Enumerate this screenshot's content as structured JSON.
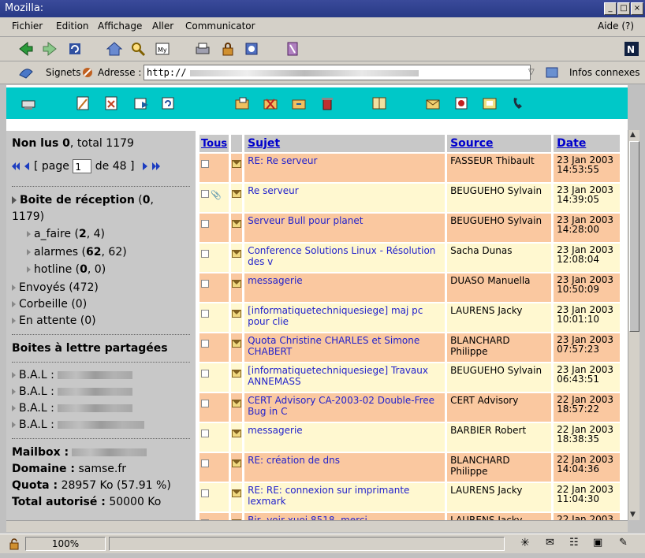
{
  "window": {
    "title": "Mozilla:"
  },
  "menu": [
    "Fichier",
    "Edition",
    "Affichage",
    "Aller",
    "Communicator"
  ],
  "help_menu": "Aide (?)",
  "location": {
    "bookmarks_label": "Signets",
    "address_label": "Adresse :",
    "url_prefix": "http://",
    "related_label": "Infos connexes"
  },
  "sidebar": {
    "unread_label": "Non lus",
    "unread_count": "0",
    "total_label": "total",
    "total_count": "1179",
    "page_prefix": "[ page",
    "page_value": "1",
    "page_suffix": "de 48 ]",
    "inbox_label": "Boite de réception",
    "inbox_unread": "0",
    "inbox_total": "1179)",
    "folders": [
      {
        "name": "a_faire",
        "unread": "2",
        "total": "4"
      },
      {
        "name": "alarmes",
        "unread": "62",
        "total": "62"
      },
      {
        "name": "hotline",
        "unread": "0",
        "total": "0"
      }
    ],
    "sent": "Envoyés (472)",
    "trash": "Corbeille (0)",
    "pending": "En attente (0)",
    "shared_title": "Boites à lettre partagées",
    "bal_label": "B.A.L :",
    "mailbox_label": "Mailbox :",
    "domain_label": "Domaine :",
    "domain_value": "samse.fr",
    "quota_label": "Quota :",
    "quota_value": "28957 Ko (57.91 %)",
    "allowed_label": "Total autorisé :",
    "allowed_value": "50000 Ko"
  },
  "table": {
    "headers": {
      "all": "Tous",
      "subject": "Sujet",
      "source": "Source",
      "date": "Date"
    },
    "rows": [
      {
        "subject": "RE: Re serveur",
        "source": "FASSEUR Thibault",
        "date": "23 Jan 2003",
        "time": "14:53:55",
        "attach": false
      },
      {
        "subject": "Re serveur",
        "source": "BEUGUEHO Sylvain",
        "date": "23 Jan 2003",
        "time": "14:39:05",
        "attach": true
      },
      {
        "subject": "Serveur Bull pour planet",
        "source": "BEUGUEHO Sylvain",
        "date": "23 Jan 2003",
        "time": "14:28:00",
        "attach": false
      },
      {
        "subject": "Conference Solutions Linux - Résolution des v",
        "source": "Sacha Dunas",
        "date": "23 Jan 2003",
        "time": "12:08:04",
        "attach": false
      },
      {
        "subject": "messagerie",
        "source": "DUASO Manuella",
        "date": "23 Jan 2003",
        "time": "10:50:09",
        "attach": false
      },
      {
        "subject": "[informatiquetechniquesiege] maj pc pour clie",
        "source": "LAURENS Jacky",
        "date": "23 Jan 2003",
        "time": "10:01:10",
        "attach": false
      },
      {
        "subject": "Quota Christine CHARLES et Simone CHABERT",
        "source": "BLANCHARD Philippe",
        "date": "23 Jan 2003",
        "time": "07:57:23",
        "attach": false
      },
      {
        "subject": "[informatiquetechniquesiege] Travaux ANNEMASS",
        "source": "BEUGUEHO Sylvain",
        "date": "23 Jan 2003",
        "time": "06:43:51",
        "attach": false
      },
      {
        "subject": "CERT Advisory CA-2003-02 Double-Free Bug in C",
        "source": "CERT Advisory",
        "date": "22 Jan 2003",
        "time": "18:57:22",
        "attach": false
      },
      {
        "subject": "messagerie",
        "source": "BARBIER Robert",
        "date": "22 Jan 2003",
        "time": "18:38:35",
        "attach": false
      },
      {
        "subject": "RE: création de dns",
        "source": "BLANCHARD Philippe",
        "date": "22 Jan 2003",
        "time": "14:04:36",
        "attach": false
      },
      {
        "subject": "RE: RE: connexion sur imprimante lexmark",
        "source": "LAURENS Jacky",
        "date": "22 Jan 2003",
        "time": "11:04:30",
        "attach": false
      },
      {
        "subject": "Bjr, voir xuoi 8518, merci",
        "source": "LAURENS Jacky",
        "date": "22 Jan 2003",
        "time": "",
        "attach": false
      }
    ]
  },
  "status": {
    "zoom": "100%"
  },
  "colors": {
    "odd_row": "#fac8a0",
    "even_row": "#fff8d0",
    "toolbar": "#00c8c8",
    "link": "#2222cc"
  }
}
